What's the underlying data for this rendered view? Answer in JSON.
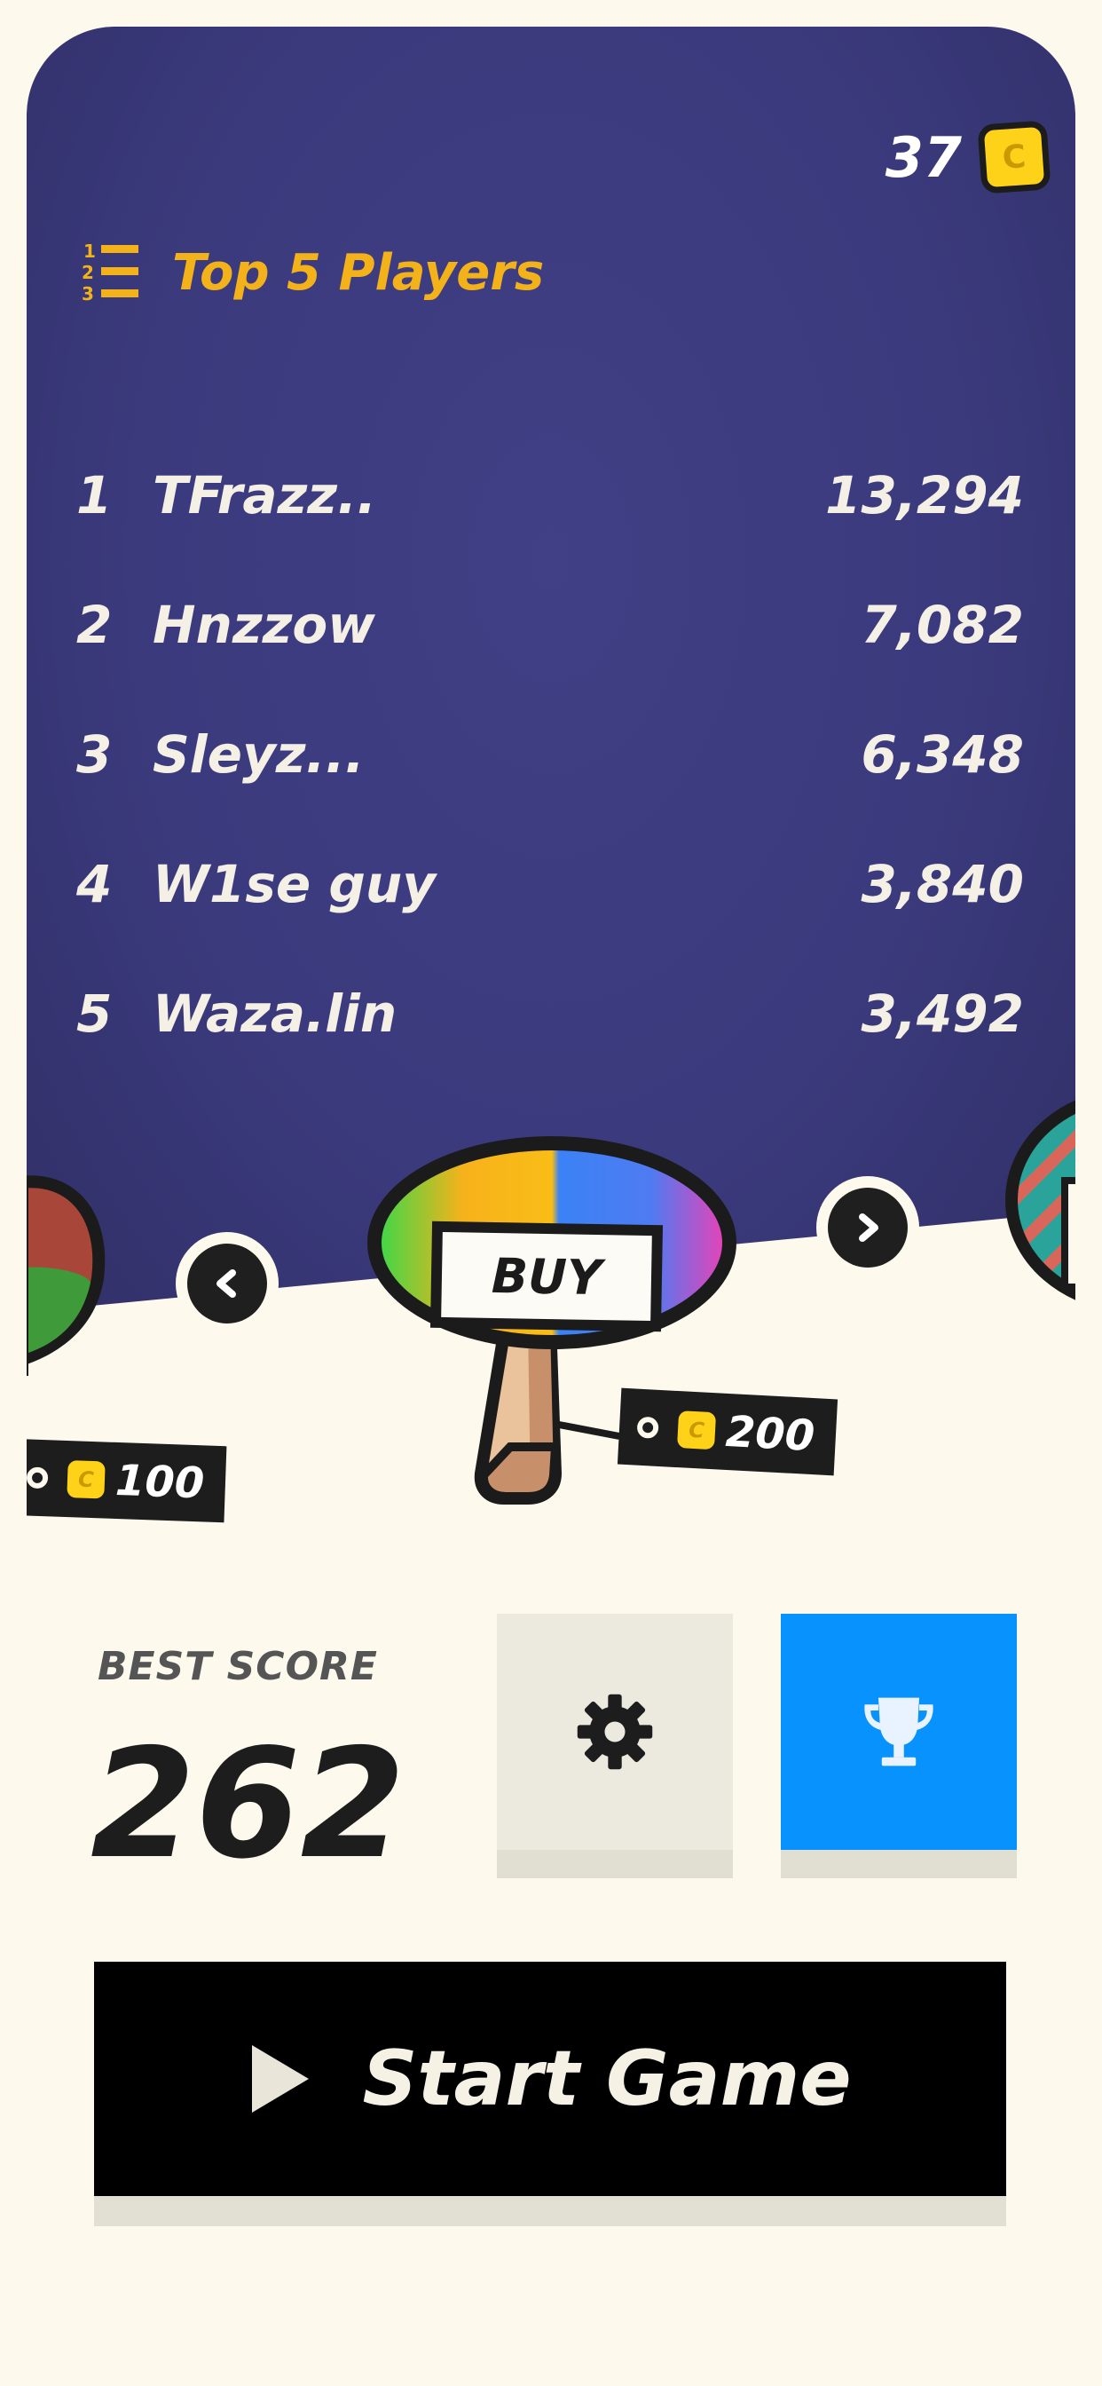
{
  "wallet": {
    "coins": "37",
    "coin_symbol": "C"
  },
  "leaderboard": {
    "title": "Top 5 Players",
    "rows": [
      {
        "rank": "1",
        "name": "TFrazz..",
        "score": "13,294"
      },
      {
        "rank": "2",
        "name": "Hnzzow",
        "score": "7,082"
      },
      {
        "rank": "3",
        "name": "Sleyz...",
        "score": "6,348"
      },
      {
        "rank": "4",
        "name": "W1se guy",
        "score": "3,840"
      },
      {
        "rank": "5",
        "name": "Waza.lin",
        "score": "3,492"
      }
    ]
  },
  "shop": {
    "buy_label": "BUY",
    "current_price": "200",
    "prev_price": "100",
    "coin_symbol": "C"
  },
  "stats": {
    "best_score_label": "BEST SCORE",
    "best_score": "262"
  },
  "actions": {
    "start_label": "Start Game"
  },
  "colors": {
    "panel": "#3b3a7d",
    "accent_gold": "#f3b21a",
    "leaderboard_button": "#0892fd",
    "settings_button": "#eceadf"
  },
  "icons": {
    "list": "numbered-list-icon",
    "coin": "coin-icon",
    "prev": "chevron-left-icon",
    "next": "chevron-right-icon",
    "settings": "gear-icon",
    "leaderboard": "trophy-icon",
    "play": "play-icon"
  }
}
